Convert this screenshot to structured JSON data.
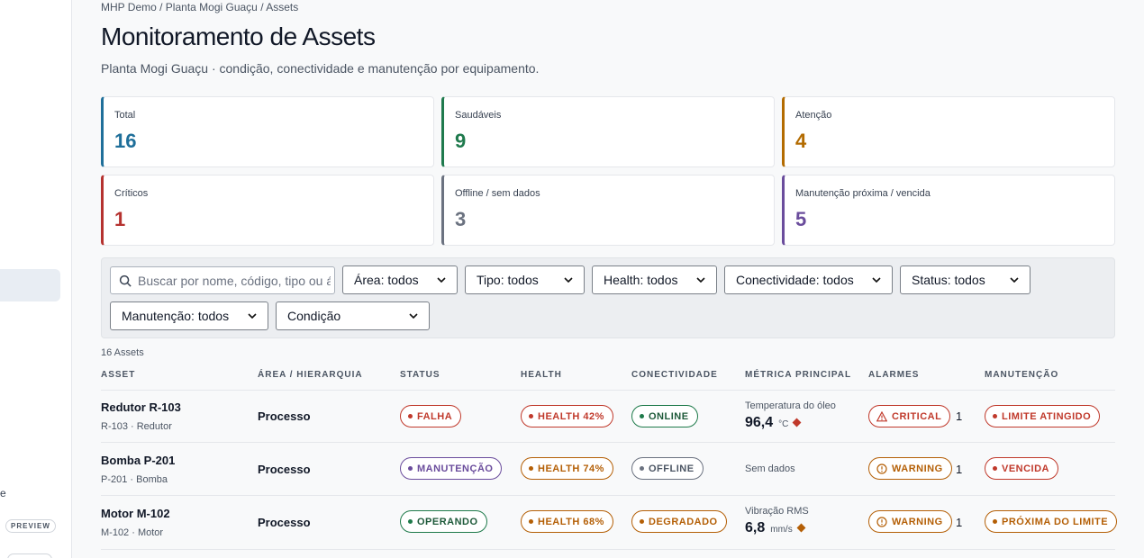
{
  "sidebar": {
    "fragment_text": "e",
    "preview_label": "PREVIEW"
  },
  "breadcrumb": "MHP Demo / Planta Mogi Guaçu / Assets",
  "title": "Monitoramento de Assets",
  "subtitle": "Planta Mogi Guaçu · condição, conectividade e manutenção por equipamento.",
  "kpis": [
    {
      "label": "Total",
      "value": "16",
      "color": "#1f6f9a"
    },
    {
      "label": "Saudáveis",
      "value": "9",
      "color": "#1f7a4d"
    },
    {
      "label": "Atenção",
      "value": "4",
      "color": "#b36b00"
    },
    {
      "label": "Críticos",
      "value": "1",
      "color": "#b5322f"
    },
    {
      "label": "Offline / sem dados",
      "value": "3",
      "color": "#6b7280"
    },
    {
      "label": "Manutenção próxima / vencida",
      "value": "5",
      "color": "#6a4c9c"
    }
  ],
  "filters": {
    "search_placeholder": "Buscar por nome, código, tipo ou área",
    "area": "Área: todos",
    "tipo": "Tipo: todos",
    "health": "Health: todos",
    "conectividade": "Conectividade: todos",
    "status": "Status: todos",
    "manutencao": "Manutenção: todos",
    "condicao": "Condição"
  },
  "count_label": "16 Assets",
  "columns": {
    "asset": "ASSET",
    "area": "ÁREA / HIERARQUIA",
    "status": "STATUS",
    "health": "HEALTH",
    "conectividade": "CONECTIVIDADE",
    "metrica": "MÉTRICA PRINCIPAL",
    "alarmes": "ALARMES",
    "manutencao": "MANUTENÇÃO"
  },
  "rows": [
    {
      "name": "Redutor R-103",
      "code": "R-103 · Redutor",
      "area": "Processo",
      "status": "FALHA",
      "health": "HEALTH 42%",
      "conn": "ONLINE",
      "metric_label": "Temperatura do óleo",
      "metric_value": "96,4",
      "metric_unit": "°C",
      "alarm": "CRITICAL",
      "alarm_count": "1",
      "maint": "LIMITE ATINGIDO"
    },
    {
      "name": "Bomba P-201",
      "code": "P-201 · Bomba",
      "area": "Processo",
      "status": "MANUTENÇÃO",
      "health": "HEALTH 74%",
      "conn": "OFFLINE",
      "metric_label": "Sem dados",
      "metric_value": "",
      "metric_unit": "",
      "alarm": "WARNING",
      "alarm_count": "1",
      "maint": "VENCIDA"
    },
    {
      "name": "Motor M-102",
      "code": "M-102 · Motor",
      "area": "Processo",
      "status": "OPERANDO",
      "health": "HEALTH 68%",
      "conn": "DEGRADADO",
      "metric_label": "Vibração RMS",
      "metric_value": "6,8",
      "metric_unit": "mm/s",
      "alarm": "WARNING",
      "alarm_count": "1",
      "maint": "PRÓXIMA DO LIMITE"
    }
  ],
  "colors": {
    "red": "#c0392b",
    "amber": "#b45f06",
    "green": "#1e7a4a",
    "gray": "#6b7280",
    "purple": "#6a4c9c"
  }
}
